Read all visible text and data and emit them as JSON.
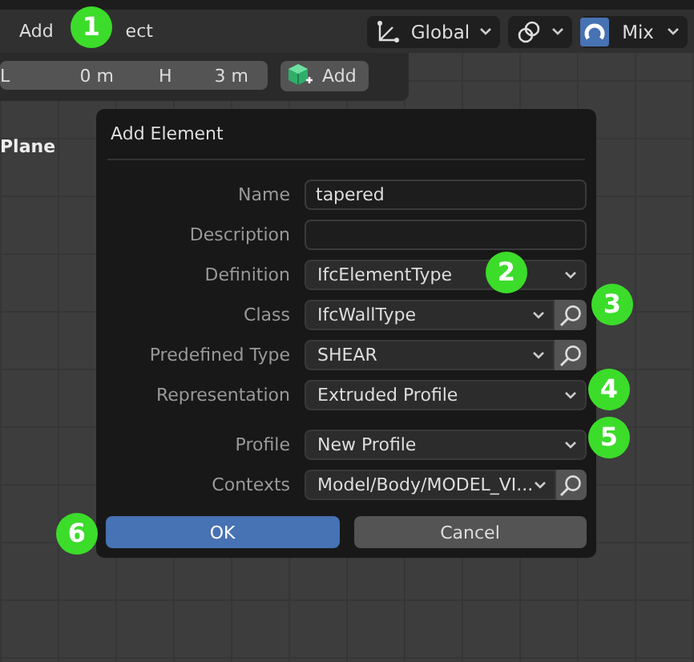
{
  "header": {
    "menus": [
      "Add",
      "ect"
    ],
    "orientation": "Global",
    "snap": "Mix"
  },
  "toolbar": {
    "fields": [
      {
        "label": "L",
        "value": "0 m"
      },
      {
        "label": "H",
        "value": "3 m"
      }
    ],
    "add_button": "Add"
  },
  "outliner": {
    "item": "Plane"
  },
  "dialog": {
    "title": "Add Element",
    "rows": [
      {
        "label": "Name",
        "kind": "text",
        "value": "tapered"
      },
      {
        "label": "Description",
        "kind": "text"
      },
      {
        "label": "Definition",
        "kind": "dropdown",
        "value": "IfcElementType"
      },
      {
        "label": "Class",
        "kind": "search",
        "value": "IfcWallType"
      },
      {
        "label": "Predefined Type",
        "kind": "search",
        "value": "SHEAR"
      },
      {
        "label": "Representation",
        "kind": "dropdown",
        "value": "Extruded Profile"
      },
      {
        "label": "Profile",
        "kind": "dropdown",
        "value": "New Profile"
      },
      {
        "label": "Contexts",
        "kind": "search",
        "value": "Model/Body/MODEL_VI..."
      }
    ],
    "buttons": [
      {
        "label": "OK",
        "default": true
      },
      {
        "label": "Cancel",
        "default": false
      }
    ]
  },
  "badges": [
    "1",
    "2",
    "3",
    "4",
    "5",
    "6"
  ]
}
